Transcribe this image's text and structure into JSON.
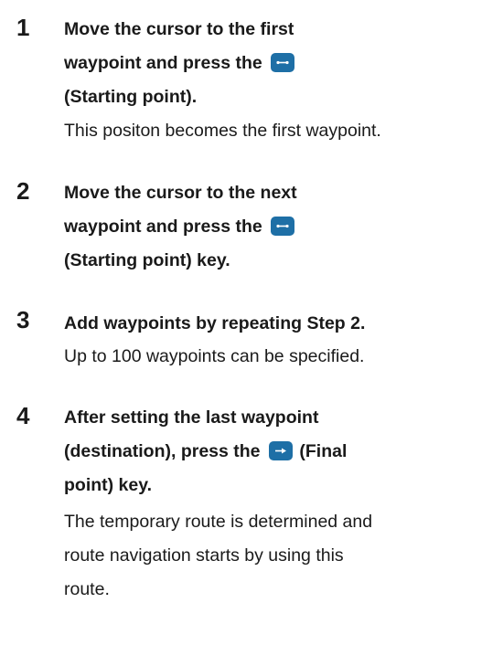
{
  "steps": [
    {
      "number": "1",
      "bold_lines": [
        "Move the cursor to the first",
        "waypoint and press the",
        "(Starting point)."
      ],
      "note_lines": [
        "This positon becomes the first waypoint."
      ]
    },
    {
      "number": "2",
      "bold_lines": [
        "Move the cursor to the next",
        "waypoint and press the",
        "(Starting point) key."
      ],
      "note_lines": []
    },
    {
      "number": "3",
      "bold_lines": [
        "Add waypoints by repeating Step 2."
      ],
      "note_lines": [
        "Up to 100 waypoints can be specified."
      ]
    },
    {
      "number": "4",
      "bold_lines": [
        "After setting the last waypoint",
        "(destination), press the",
        "(Final",
        "point) key."
      ],
      "note_lines": [
        "The temporary route is determined and",
        "route navigation starts by using this",
        "route."
      ]
    }
  ],
  "icons": {
    "start_key": "starting-point-key-icon",
    "final_key": "final-point-key-icon",
    "key_color": "#1e6fa6"
  }
}
